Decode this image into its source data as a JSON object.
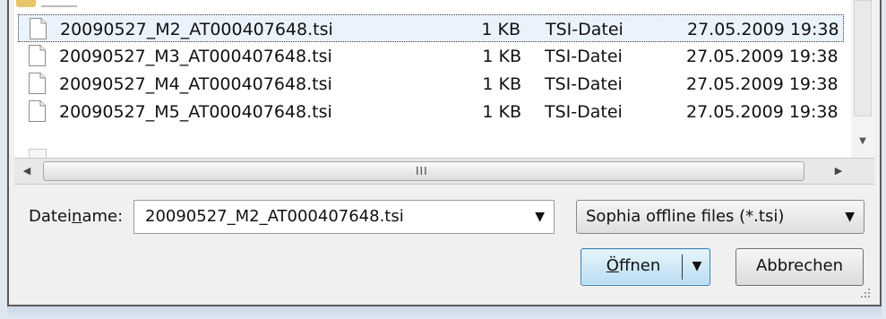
{
  "file_list": {
    "rows": [
      {
        "name": "20090527_M2_AT000407648.tsi",
        "size": "1 KB",
        "type": "TSI-Datei",
        "date": "27.05.2009 19:38",
        "selected": true
      },
      {
        "name": "20090527_M3_AT000407648.tsi",
        "size": "1 KB",
        "type": "TSI-Datei",
        "date": "27.05.2009 19:38",
        "selected": false
      },
      {
        "name": "20090527_M4_AT000407648.tsi",
        "size": "1 KB",
        "type": "TSI-Datei",
        "date": "27.05.2009 19:38",
        "selected": false
      },
      {
        "name": "20090527_M5_AT000407648.tsi",
        "size": "1 KB",
        "type": "TSI-Datei",
        "date": "27.05.2009 19:38",
        "selected": false
      }
    ]
  },
  "scrollbar": {
    "grip_glyph": "III",
    "left_arrow": "◀",
    "right_arrow": "▶",
    "down_arrow": "▼"
  },
  "filename": {
    "label_prefix": "Datei",
    "label_accesskey": "n",
    "label_suffix": "ame:",
    "value": "20090527_M2_AT000407648.tsi",
    "arrow": "▼"
  },
  "filter": {
    "value": "Sophia offline files  (*.tsi)",
    "arrow": "▼"
  },
  "buttons": {
    "open_accesskey": "Ö",
    "open_rest": "ffnen",
    "open_arrow": "▼",
    "cancel_label": "Abbrechen"
  },
  "icons": {
    "file": "file-icon",
    "folder": "folder-icon",
    "resize_grip": "resize-grip-icon"
  }
}
